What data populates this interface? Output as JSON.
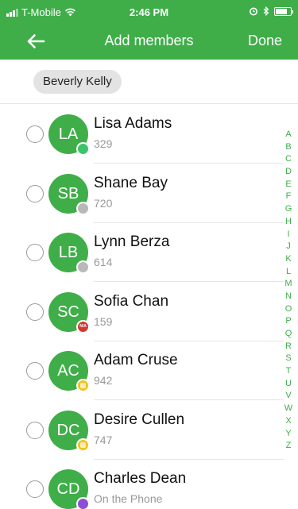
{
  "status_bar": {
    "carrier": "T-Mobile",
    "time": "2:46 PM",
    "icons": [
      "signal-icon",
      "wifi-icon",
      "alarm-icon",
      "bluetooth-icon",
      "battery-icon"
    ],
    "battery_level": 0.8
  },
  "header": {
    "back_icon": "back-arrow-icon",
    "title": "Add members",
    "done_label": "Done"
  },
  "selected": [
    {
      "name": "Beverly Kelly"
    }
  ],
  "contacts": [
    {
      "initials": "LA",
      "name": "Lisa Adams",
      "detail": "329",
      "status": "available",
      "status_color": "#3cc46b",
      "status_label": ""
    },
    {
      "initials": "SB",
      "name": "Shane Bay",
      "detail": "720",
      "status": "offline",
      "status_color": "#b8b8b8",
      "status_label": ""
    },
    {
      "initials": "LB",
      "name": "Lynn Berza",
      "detail": "614",
      "status": "offline",
      "status_color": "#b8b8b8",
      "status_label": ""
    },
    {
      "initials": "SC",
      "name": "Sofia Chan",
      "detail": "159",
      "status": "not-available",
      "status_color": "#d03a33",
      "status_label": "N/A"
    },
    {
      "initials": "AC",
      "name": "Adam Cruse",
      "detail": "942",
      "status": "idle",
      "status_color": "#f4c21b",
      "status_label": ""
    },
    {
      "initials": "DC",
      "name": "Desire Cullen",
      "detail": "747",
      "status": "idle",
      "status_color": "#f4c21b",
      "status_label": ""
    },
    {
      "initials": "CD",
      "name": "Charles Dean",
      "detail": "On the Phone",
      "status": "on-phone",
      "status_color": "#8e4fd6",
      "status_label": ""
    }
  ],
  "alphabet": [
    "A",
    "B",
    "C",
    "D",
    "E",
    "F",
    "G",
    "H",
    "I",
    "J",
    "K",
    "L",
    "M",
    "N",
    "O",
    "P",
    "Q",
    "R",
    "S",
    "T",
    "U",
    "V",
    "W",
    "X",
    "Y",
    "Z"
  ],
  "colors": {
    "accent": "#3fae49",
    "chip_background": "#e3e3e3"
  }
}
